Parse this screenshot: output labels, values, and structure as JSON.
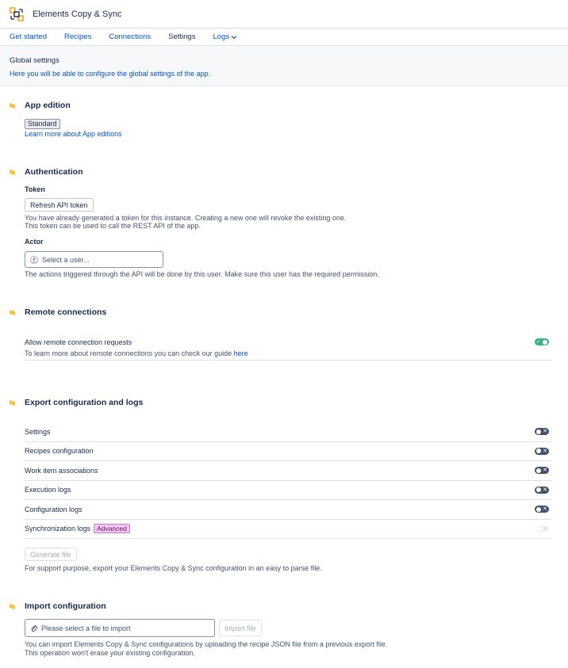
{
  "app": {
    "title": "Elements Copy & Sync"
  },
  "tabs": [
    {
      "label": "Get started"
    },
    {
      "label": "Recipes"
    },
    {
      "label": "Connections"
    },
    {
      "label": "Settings"
    },
    {
      "label": "Logs"
    }
  ],
  "intro": {
    "title": "Global settings",
    "subtitle": "Here you will be able to configure the global settings of the app."
  },
  "app_edition": {
    "title": "App edition",
    "value": "Standard",
    "link": "Learn more about App editions"
  },
  "authentication": {
    "title": "Authentication",
    "token_label": "Token",
    "refresh_button": "Refresh API token",
    "token_help_1": "You have already generated a token for this instance. Creating a new one will revoke the existing one.",
    "token_help_2": "This token can be used to call the REST API of the app.",
    "actor_label": "Actor",
    "actor_placeholder": "Select a user...",
    "actor_help": "The actions triggered through the API will be done by this user. Make sure this user has the required permission."
  },
  "remote": {
    "title": "Remote connections",
    "allow_label": "Allow remote connection requests",
    "allow_enabled": true,
    "guide_text": "To learn more about remote connections you can check our guide",
    "guide_link": "here"
  },
  "export": {
    "title": "Export configuration and logs",
    "items": [
      {
        "label": "Settings",
        "enabled": false
      },
      {
        "label": "Recipes configuration",
        "enabled": false
      },
      {
        "label": "Work item associations",
        "enabled": false
      },
      {
        "label": "Execution logs",
        "enabled": false
      },
      {
        "label": "Configuration logs",
        "enabled": false
      },
      {
        "label": "Synchronization logs",
        "badge": "Advanced",
        "enabled": false,
        "disabled": true
      }
    ],
    "generate_button": "Generate file",
    "help": "For support purpose, export your Elements Copy & Sync configuration in an easy to parse file."
  },
  "import": {
    "title": "Import configuration",
    "file_placeholder": "Please select a file to import",
    "import_button": "Import file",
    "help_1": "You can import Elements Copy & Sync configurations by uploading the recipe JSON file from a previous export file.",
    "help_2": "This operation won't erase your existing configuration."
  },
  "colors": {
    "link": "#0052cc",
    "accent_flag": "#f5c542",
    "toggle_on": "#36b37e",
    "toggle_off": "#42526e",
    "badge_bg": "#f3c6f3"
  }
}
